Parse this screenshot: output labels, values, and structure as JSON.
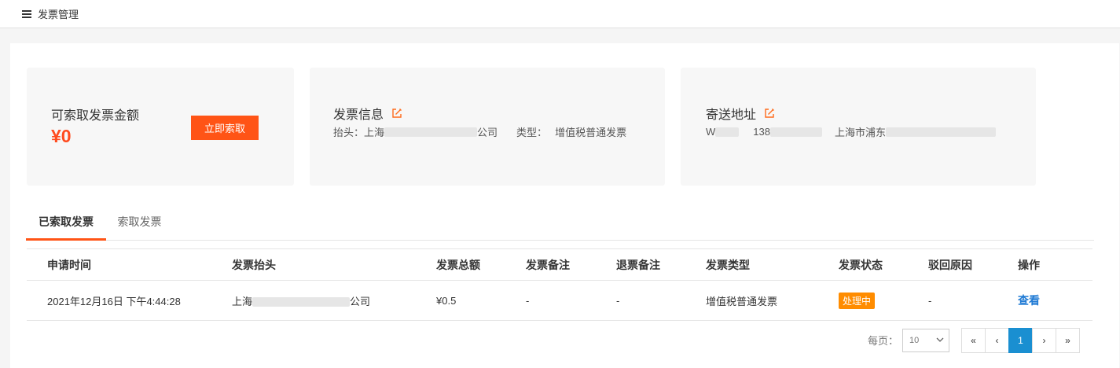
{
  "header": {
    "title": "发票管理"
  },
  "summary": {
    "amount_label": "可索取发票金额",
    "amount_value": "¥0",
    "request_button": "立即索取"
  },
  "invoice_info": {
    "title": "发票信息",
    "header_label": "抬头：",
    "header_prefix": "上海",
    "header_suffix": "公司",
    "type_label": "类型：",
    "type_value": "增值税普通发票"
  },
  "shipping": {
    "title": "寄送地址",
    "name_prefix": "W",
    "phone_prefix": "138",
    "address_prefix": "上海市浦东"
  },
  "tabs": [
    {
      "label": "已索取发票",
      "active": true
    },
    {
      "label": "索取发票",
      "active": false
    }
  ],
  "table": {
    "columns": [
      "申请时间",
      "发票抬头",
      "发票总额",
      "发票备注",
      "退票备注",
      "发票类型",
      "发票状态",
      "驳回原因",
      "操作"
    ],
    "rows": [
      {
        "time": "2021年12月16日 下午4:44:28",
        "header_prefix": "上海",
        "header_suffix": "公司",
        "total": "¥0.5",
        "invoice_note": "-",
        "refund_note": "-",
        "type": "增值税普通发票",
        "status": "处理中",
        "reject_reason": "-",
        "action": "查看"
      }
    ]
  },
  "pagination": {
    "per_page_label": "每页：",
    "per_page_value": "10",
    "first": "«",
    "prev": "‹",
    "current_page": "1",
    "next": "›",
    "last": "»"
  },
  "colors": {
    "accent": "#ff5416",
    "amount": "#ff4b1f",
    "status_badge": "#ff8c00",
    "link": "#1f7ad4",
    "current_page": "#1a8fd1"
  }
}
